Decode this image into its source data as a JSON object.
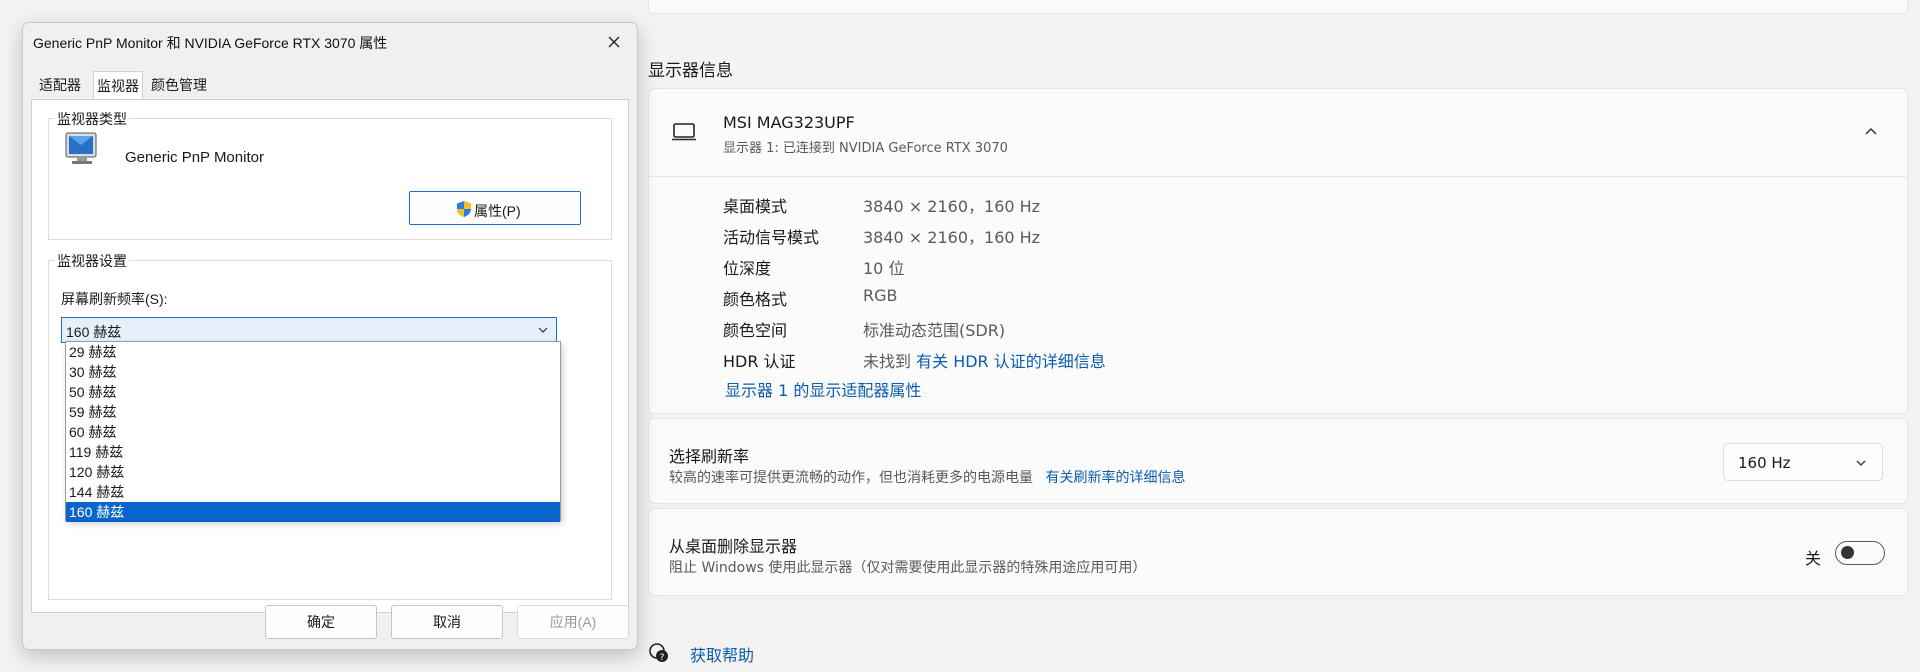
{
  "settings": {
    "section_title": "显示器信息",
    "monitor": {
      "name": "MSI MAG323UPF",
      "subtitle": "显示器 1: 已连接到 NVIDIA GeForce RTX 3070"
    },
    "info_rows": [
      {
        "label": "桌面模式",
        "value": "3840 × 2160，160 Hz"
      },
      {
        "label": "活动信号模式",
        "value": "3840 × 2160，160 Hz"
      },
      {
        "label": "位深度",
        "value": "10 位"
      },
      {
        "label": "颜色格式",
        "value": "RGB"
      },
      {
        "label": "颜色空间",
        "value": "标准动态范围(SDR)"
      },
      {
        "label": "HDR 认证",
        "value": "未找到",
        "link": "有关 HDR 认证的详细信息"
      }
    ],
    "adapter_link": "显示器 1 的显示适配器属性",
    "refresh": {
      "title": "选择刷新率",
      "description": "较高的速率可提供更流畅的动作，但也消耗更多的电源电量",
      "link": "有关刷新率的详细信息",
      "selected": "160 Hz"
    },
    "remove": {
      "title": "从桌面删除显示器",
      "description": "阻止 Windows 使用此显示器（仅对需要使用此显示器的特殊用途应用可用）",
      "toggle_label": "关",
      "toggle_state": "off"
    },
    "help": "获取帮助"
  },
  "dialog": {
    "title": "Generic PnP Monitor 和 NVIDIA GeForce RTX 3070 属性",
    "tabs": [
      "适配器",
      "监视器",
      "颜色管理"
    ],
    "active_tab": "监视器",
    "monitor_type_label": "监视器类型",
    "monitor_type_name": "Generic PnP Monitor",
    "properties_button": "属性(P)",
    "monitor_settings_label": "监视器设置",
    "refresh_rate_label": "屏幕刷新频率(S):",
    "refresh_rate_selected": "160 赫兹",
    "refresh_rate_options": [
      "29 赫兹",
      "30 赫兹",
      "50 赫兹",
      "59 赫兹",
      "60 赫兹",
      "119 赫兹",
      "120 赫兹",
      "144 赫兹",
      "160 赫兹"
    ],
    "buttons": {
      "ok": "确定",
      "cancel": "取消",
      "apply": "应用(A)"
    }
  },
  "colors": {
    "link": "#0b5cad",
    "selection": "#0a64c9",
    "focus_border": "#1b6fd1"
  },
  "icons": [
    "monitor-icon",
    "chevron-up-icon",
    "chevron-down-icon",
    "help-icon",
    "close-icon",
    "shield-icon",
    "crt-monitor-icon"
  ]
}
